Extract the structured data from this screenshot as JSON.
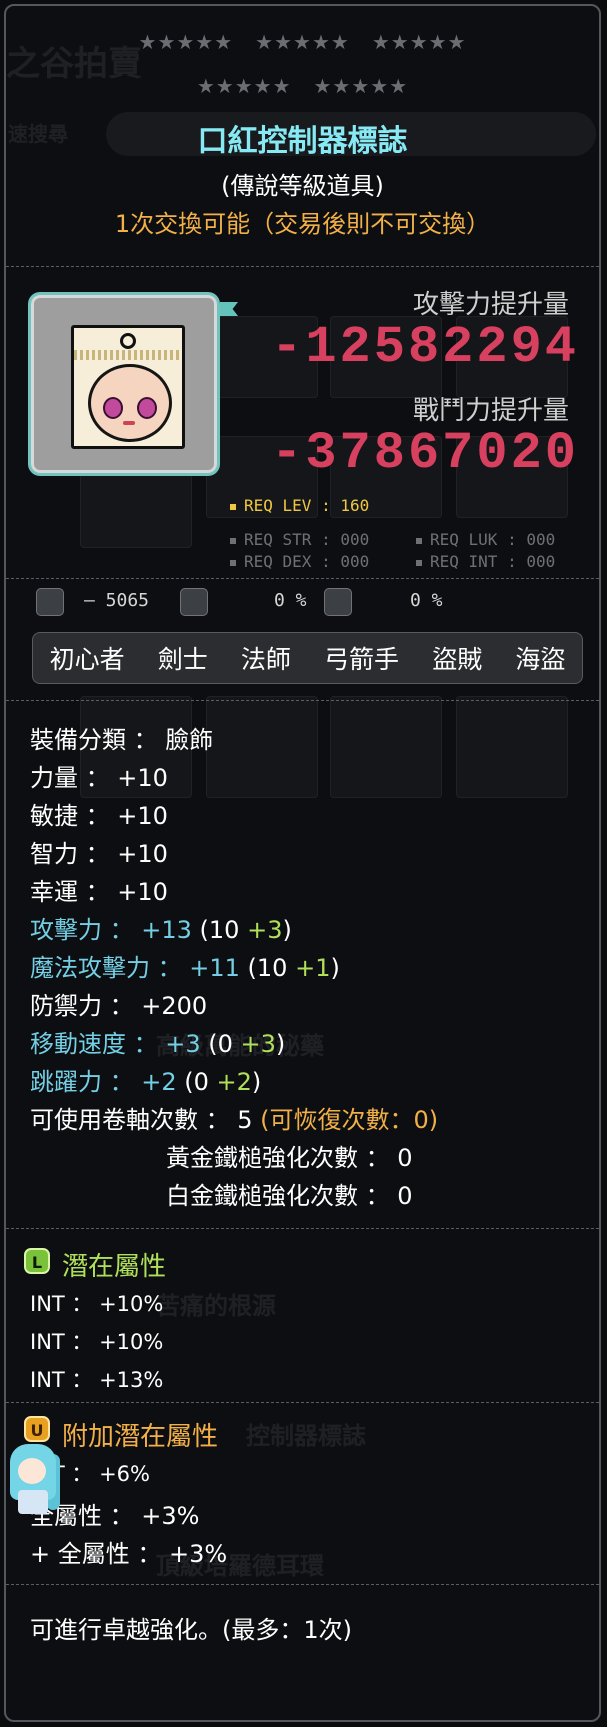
{
  "item": {
    "stars_row1": [
      "★★★★★",
      "★★★★★",
      "★★★★★"
    ],
    "stars_row2": [
      "★★★★★",
      "★★★★★"
    ],
    "name": "口紅控制器標誌",
    "grade": "(傳說等級道具)",
    "trade_note": "1次交換可能（交易後則不可交換）",
    "icon": "lipstick-controller-emblem-icon"
  },
  "power": {
    "attack_label": "攻擊力提升量",
    "attack_value": "-12582294",
    "combat_label": "戰鬥力提升量",
    "combat_value": "-37867020"
  },
  "requirements": {
    "level": "REQ LEV : 160",
    "str": "REQ STR : 000",
    "luk": "REQ LUK : 000",
    "dex": "REQ DEX : 000",
    "int": "REQ INT : 000"
  },
  "mini_stats": {
    "value1": "– 5065",
    "value2": "0 %",
    "value3": "0 %",
    "icons": [
      "armor-break-icon",
      "knockback-icon",
      "shield-icon"
    ]
  },
  "jobs": [
    "初心者",
    "劍士",
    "法師",
    "弓箭手",
    "盜賊",
    "海盜"
  ],
  "stats": {
    "category": "裝備分類 ： 臉飾",
    "str": "力量 ： +10",
    "dex": "敏捷 ： +10",
    "int": "智力 ： +10",
    "luk": "幸運 ： +10",
    "att_main": "攻擊力 ： +13",
    "att_open": " (10 ",
    "att_bonus": "+3",
    "att_close": ")",
    "matt_main": "魔法攻擊力 ： +11",
    "matt_open": " (10 ",
    "matt_bonus": "+1",
    "matt_close": ")",
    "def": "防禦力 ： +200",
    "speed_main": "移動速度 ： +3",
    "speed_open": " (0 ",
    "speed_bonus": "+3",
    "speed_close": ")",
    "jump_main": "跳躍力 ： +2",
    "jump_open": " (0 ",
    "jump_bonus": "+2",
    "jump_close": ")",
    "scroll_main": "可使用卷軸次數 ： 5",
    "scroll_restore": "(可恢復次數：0)",
    "gold_hammer": "黃金鐵槌強化次數 ： 0",
    "platinum_hammer": "白金鐵槌強化次數 ： 0"
  },
  "potential": {
    "title": "潛在屬性",
    "badge": "L",
    "lines": [
      "INT ： +10%",
      "INT ： +10%",
      "INT ： +13%"
    ]
  },
  "additional_potential": {
    "title": "附加潛在屬性",
    "badge": "U",
    "lines": [
      "INT ： +6%",
      "全屬性 ： +3%",
      "+ 全屬性 ： +3%"
    ]
  },
  "footer": "可進行卓越強化。(最多：1次)",
  "background_hints": [
    "之谷拍賣",
    "速搜尋",
    "高級萬能的秘藥",
    "苦痛的根源",
    "控制器標誌",
    "頂級培羅德耳環"
  ],
  "colors": {
    "name": "#87e9f3",
    "trade": "#f2b048",
    "negative": "#d8405f",
    "blue_stat": "#74cfe4",
    "bonus": "#b0e05a"
  }
}
